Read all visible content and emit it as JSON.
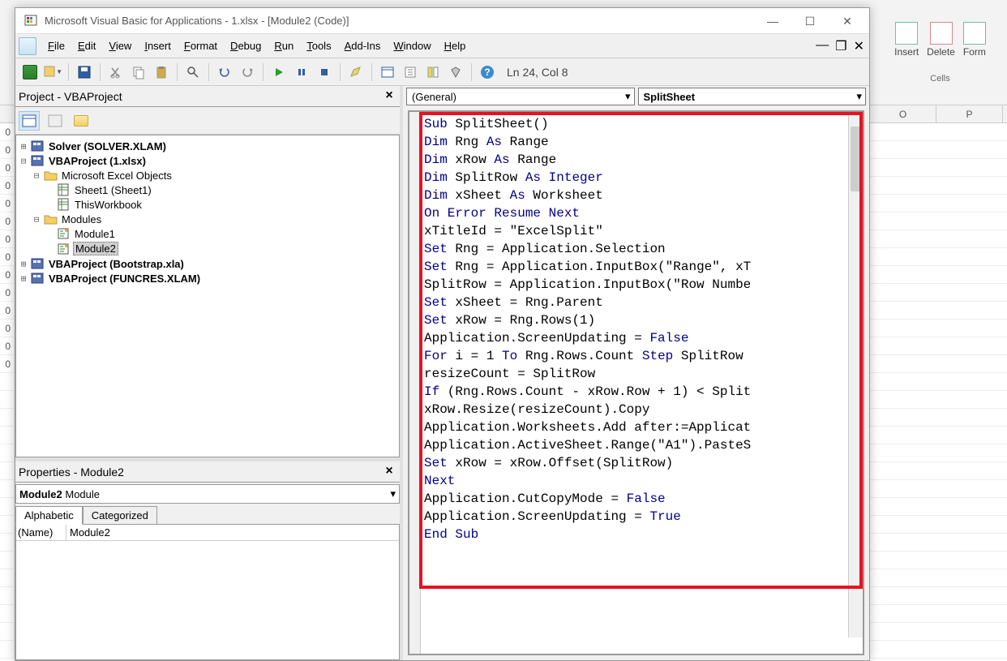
{
  "window": {
    "title": "Microsoft Visual Basic for Applications - 1.xlsx - [Module2 (Code)]"
  },
  "menubar": [
    "File",
    "Edit",
    "View",
    "Insert",
    "Format",
    "Debug",
    "Run",
    "Tools",
    "Add-Ins",
    "Window",
    "Help"
  ],
  "status_position": "Ln 24, Col 8",
  "project_panel": {
    "title": "Project - VBAProject",
    "tree": [
      {
        "level": 1,
        "exp": "+",
        "icon": "vba",
        "label": "Solver (SOLVER.XLAM)",
        "bold": true
      },
      {
        "level": 1,
        "exp": "-",
        "icon": "vba",
        "label": "VBAProject (1.xlsx)",
        "bold": true
      },
      {
        "level": 2,
        "exp": "-",
        "icon": "folder",
        "label": "Microsoft Excel Objects",
        "bold": false
      },
      {
        "level": 3,
        "exp": "",
        "icon": "sheet",
        "label": "Sheet1 (Sheet1)",
        "bold": false
      },
      {
        "level": 3,
        "exp": "",
        "icon": "sheet",
        "label": "ThisWorkbook",
        "bold": false
      },
      {
        "level": 2,
        "exp": "-",
        "icon": "folder",
        "label": "Modules",
        "bold": false
      },
      {
        "level": 3,
        "exp": "",
        "icon": "module",
        "label": "Module1",
        "bold": false
      },
      {
        "level": 3,
        "exp": "",
        "icon": "module",
        "label": "Module2",
        "bold": false,
        "selected": true
      },
      {
        "level": 1,
        "exp": "+",
        "icon": "vba",
        "label": "VBAProject (Bootstrap.xla)",
        "bold": true
      },
      {
        "level": 1,
        "exp": "+",
        "icon": "vba",
        "label": "VBAProject (FUNCRES.XLAM)",
        "bold": true
      }
    ]
  },
  "properties_panel": {
    "title": "Properties - Module2",
    "combo_name": "Module2",
    "combo_type": "Module",
    "tabs": [
      "Alphabetic",
      "Categorized"
    ],
    "active_tab": 0,
    "rows": [
      {
        "name": "(Name)",
        "value": "Module2"
      }
    ]
  },
  "code_dropdowns": {
    "left": "(General)",
    "right": "SplitSheet"
  },
  "code_tokens": [
    [
      {
        "t": "Sub",
        "k": 1
      },
      {
        "t": " SplitSheet()"
      }
    ],
    [
      {
        "t": "Dim",
        "k": 1
      },
      {
        "t": " Rng "
      },
      {
        "t": "As",
        "k": 1
      },
      {
        "t": " Range"
      }
    ],
    [
      {
        "t": "Dim",
        "k": 1
      },
      {
        "t": " xRow "
      },
      {
        "t": "As",
        "k": 1
      },
      {
        "t": " Range"
      }
    ],
    [
      {
        "t": "Dim",
        "k": 1
      },
      {
        "t": " SplitRow "
      },
      {
        "t": "As",
        "k": 1
      },
      {
        "t": " "
      },
      {
        "t": "Integer",
        "k": 1
      }
    ],
    [
      {
        "t": "Dim",
        "k": 1
      },
      {
        "t": " xSheet "
      },
      {
        "t": "As",
        "k": 1
      },
      {
        "t": " Worksheet"
      }
    ],
    [
      {
        "t": "On Error Resume Next",
        "k": 1
      }
    ],
    [
      {
        "t": "xTitleId = \"ExcelSplit\""
      }
    ],
    [
      {
        "t": "Set",
        "k": 1
      },
      {
        "t": " Rng = Application.Selection"
      }
    ],
    [
      {
        "t": "Set",
        "k": 1
      },
      {
        "t": " Rng = Application.InputBox(\"Range\", xT"
      }
    ],
    [
      {
        "t": "SplitRow = Application.InputBox(\"Row Numbe"
      }
    ],
    [
      {
        "t": "Set",
        "k": 1
      },
      {
        "t": " xSheet = Rng.Parent"
      }
    ],
    [
      {
        "t": "Set",
        "k": 1
      },
      {
        "t": " xRow = Rng.Rows(1)"
      }
    ],
    [
      {
        "t": "Application.ScreenUpdating = "
      },
      {
        "t": "False",
        "k": 1
      }
    ],
    [
      {
        "t": "For",
        "k": 1
      },
      {
        "t": " i = 1 "
      },
      {
        "t": "To",
        "k": 1
      },
      {
        "t": " Rng.Rows.Count "
      },
      {
        "t": "Step",
        "k": 1
      },
      {
        "t": " SplitRow"
      }
    ],
    [
      {
        "t": "resizeCount = SplitRow"
      }
    ],
    [
      {
        "t": "If",
        "k": 1
      },
      {
        "t": " (Rng.Rows.Count - xRow.Row + 1) < Split"
      }
    ],
    [
      {
        "t": "xRow.Resize(resizeCount).Copy"
      }
    ],
    [
      {
        "t": "Application.Worksheets.Add after:=Applicat"
      }
    ],
    [
      {
        "t": "Application.ActiveSheet.Range(\"A1\").PasteS"
      }
    ],
    [
      {
        "t": "Set",
        "k": 1
      },
      {
        "t": " xRow = xRow.Offset(SplitRow)"
      }
    ],
    [
      {
        "t": "Next",
        "k": 1
      }
    ],
    [
      {
        "t": "Application.CutCopyMode = "
      },
      {
        "t": "False",
        "k": 1
      }
    ],
    [
      {
        "t": "Application.ScreenUpdating = "
      },
      {
        "t": "True",
        "k": 1
      }
    ],
    [
      {
        "t": "End Sub",
        "k": 1
      }
    ]
  ],
  "excel": {
    "ribbon_buttons": [
      "Insert",
      "Delete",
      "Form"
    ],
    "ribbon_group": "Cells",
    "columns": [
      "O",
      "P"
    ],
    "row_peeks": [
      "0",
      "0",
      "0",
      "0",
      "0",
      "0",
      "0",
      "0",
      "0",
      "0",
      "0",
      "0",
      "0",
      "0"
    ]
  }
}
